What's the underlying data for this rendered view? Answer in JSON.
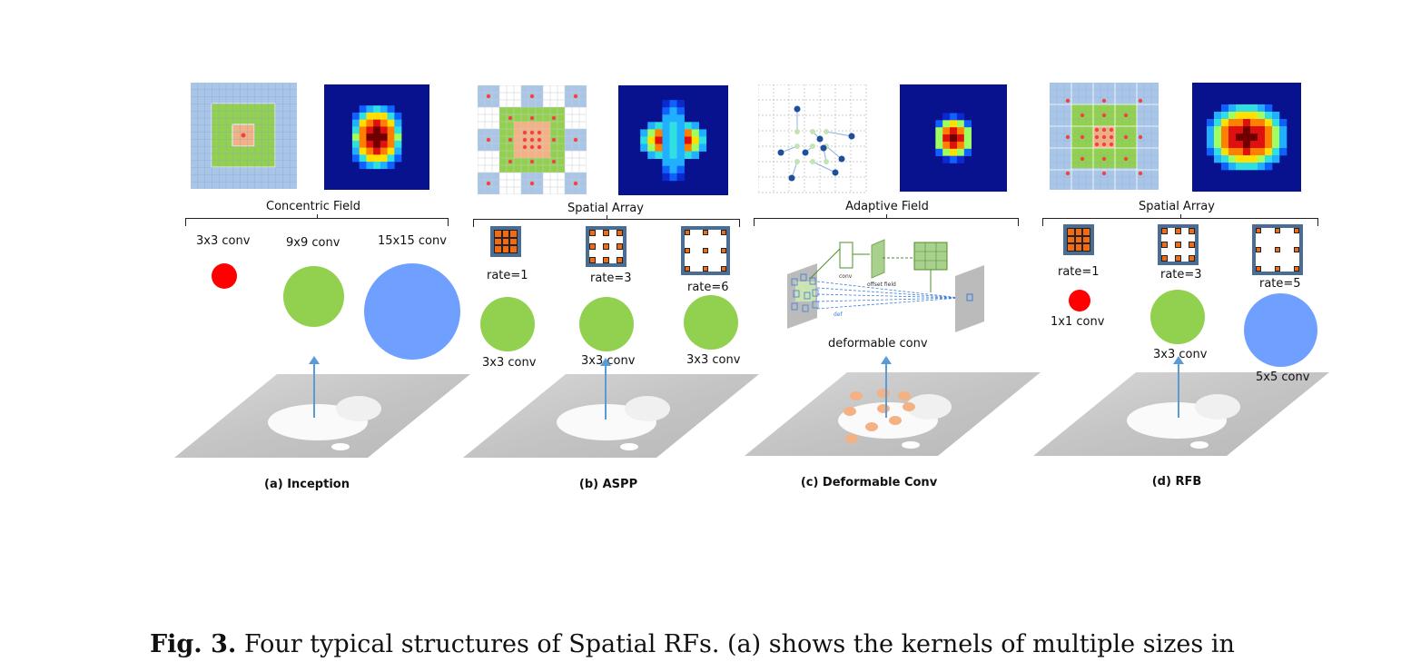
{
  "panels": [
    {
      "id": "a",
      "group_label": "Concentric Field",
      "sub_caption": "(a) Inception",
      "kernels": [
        {
          "label": "3x3 conv",
          "color": "#ff0000"
        },
        {
          "label": "9x9 conv",
          "color": "#92d050"
        },
        {
          "label": "15x15 conv",
          "color": "#6fa0ff"
        }
      ]
    },
    {
      "id": "b",
      "group_label": "Spatial Array",
      "sub_caption": "(b) ASPP",
      "rates": [
        "rate=1",
        "rate=3",
        "rate=6"
      ],
      "kernels": [
        {
          "label": "3x3 conv",
          "color": "#92d050"
        },
        {
          "label": "3x3 conv",
          "color": "#92d050"
        },
        {
          "label": "3x3 conv",
          "color": "#92d050"
        }
      ]
    },
    {
      "id": "c",
      "group_label": "Adaptive Field",
      "sub_caption": "(c) Deformable Conv",
      "inset": {
        "conv_label": "conv",
        "offset_label": "offset field",
        "deform_label": "deformable conv",
        "def_label": "def"
      }
    },
    {
      "id": "d",
      "group_label": "Spatial Array",
      "sub_caption": "(d) RFB",
      "rates": [
        "rate=1",
        "rate=3",
        "rate=5"
      ],
      "kernels": [
        {
          "label": "1x1 conv",
          "color": "#ff0000"
        },
        {
          "label": "3x3 conv",
          "color": "#92d050"
        },
        {
          "label": "5x5 conv",
          "color": "#6fa0ff"
        }
      ]
    }
  ],
  "colors": {
    "grid_blue": "#a9c6e8",
    "grid_green": "#92d050",
    "grid_orange": "#f4b183",
    "dot_red": "#ef4444",
    "kernel_orange": "#f26b12",
    "kernel_border": "#4a6e93",
    "arrow_blue": "#5b9bd5",
    "heat_bg": "#08128f",
    "deform_dot": "#f4b183"
  },
  "caption": {
    "label": "Fig. 3.",
    "text": " Four typical structures of Spatial RFs. (a) shows the kernels of multiple sizes in"
  }
}
